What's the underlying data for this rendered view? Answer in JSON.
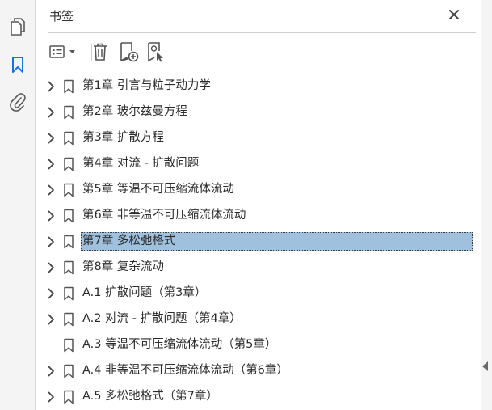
{
  "rail": {
    "items": [
      {
        "icon": "pages-icon"
      },
      {
        "icon": "bookmark-icon",
        "active": true
      },
      {
        "icon": "attachment-icon"
      }
    ]
  },
  "panel": {
    "title": "书签"
  },
  "toolbar": {
    "buttons": [
      "options-menu-icon",
      "delete-icon",
      "new-bookmark-icon",
      "bookmark-from-structure-icon"
    ]
  },
  "bookmarks": [
    {
      "label": "第1章  引言与粒子动力学",
      "expandable": true
    },
    {
      "label": "第2章  玻尔兹曼方程",
      "expandable": true
    },
    {
      "label": "第3章  扩散方程",
      "expandable": true
    },
    {
      "label": "第4章  对流 - 扩散问题",
      "expandable": true
    },
    {
      "label": "第5章  等温不可压缩流体流动",
      "expandable": true
    },
    {
      "label": "第6章  非等温不可压缩流体流动",
      "expandable": true
    },
    {
      "label": "第7章  多松弛格式",
      "expandable": true,
      "selected": true
    },
    {
      "label": "第8章  复杂流动",
      "expandable": true
    },
    {
      "label": "A.1  扩散问题（第3章）",
      "expandable": true
    },
    {
      "label": "A.2  对流 - 扩散问题（第4章）",
      "expandable": true
    },
    {
      "label": "A.3  等温不可压缩流体流动（第5章）",
      "expandable": false
    },
    {
      "label": "A.4  非等温不可压缩流体流动（第6章）",
      "expandable": true
    },
    {
      "label": "A.5  多松弛格式（第7章）",
      "expandable": true
    }
  ],
  "colors": {
    "selection": "#9fc1de",
    "icon": "#5a5a5a",
    "active_icon": "#1473e6"
  }
}
